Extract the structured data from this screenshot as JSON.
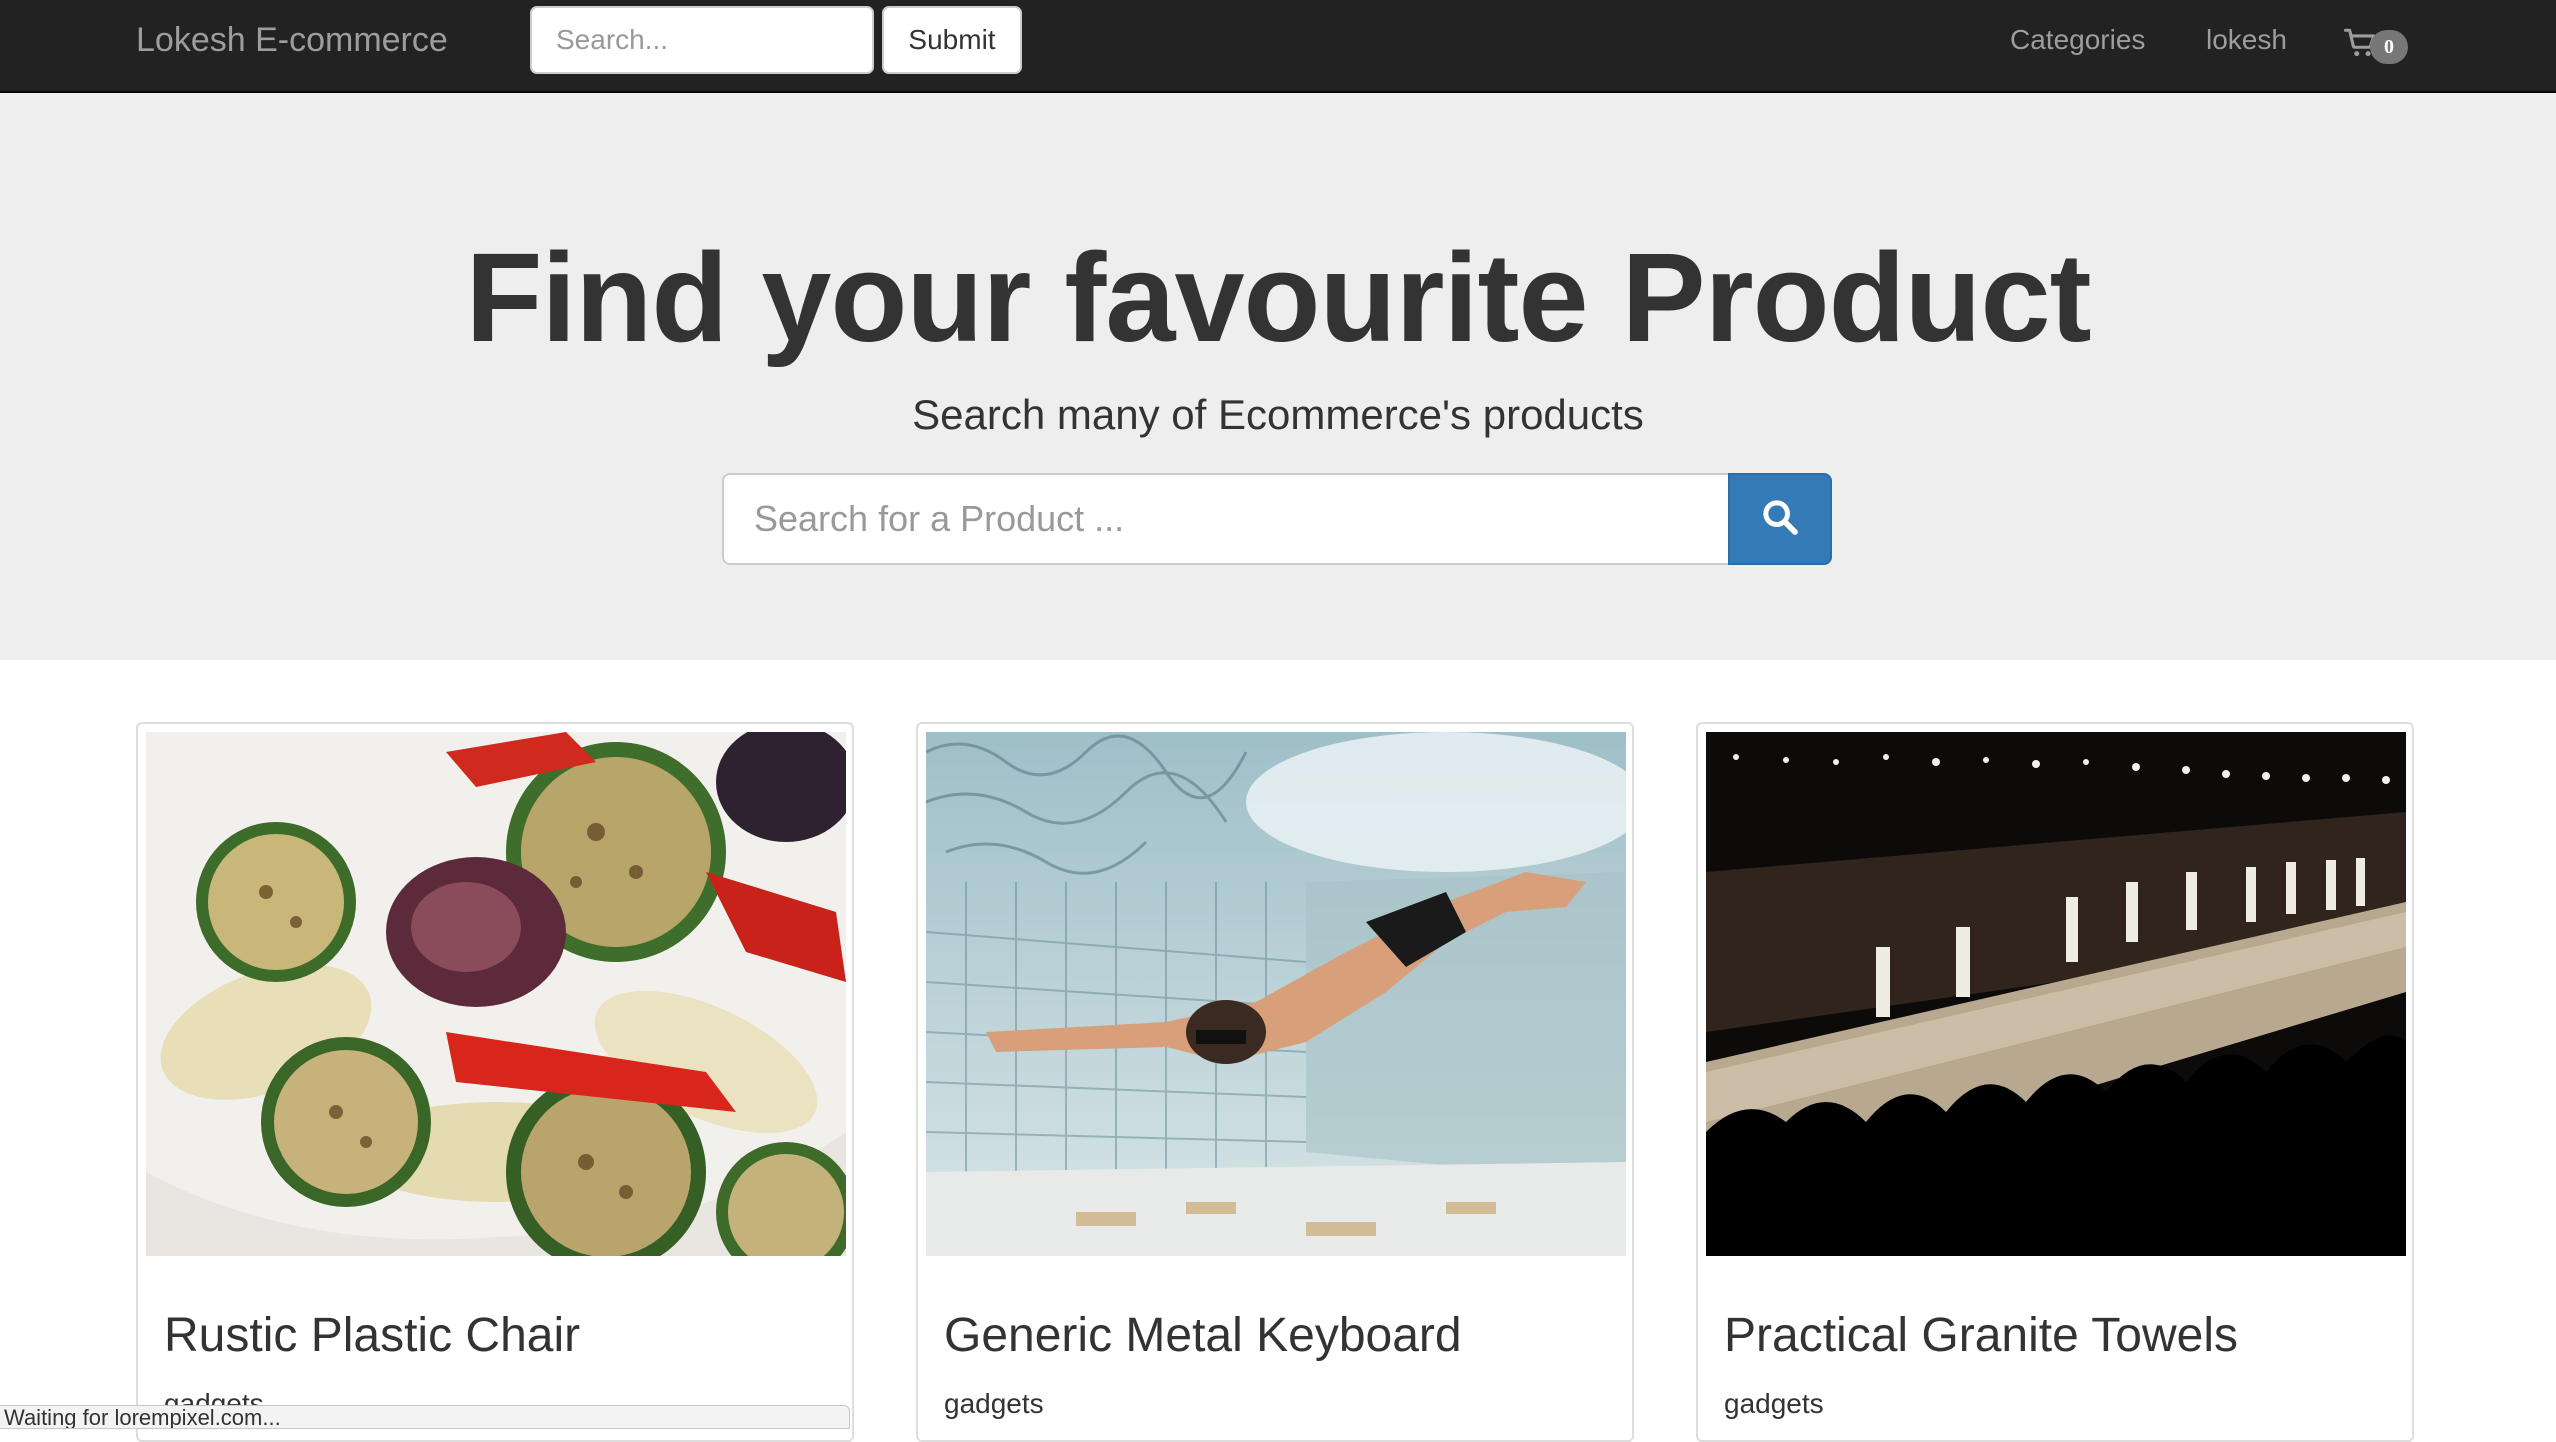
{
  "navbar": {
    "brand": "Lokesh E-commerce",
    "search_placeholder": "Search...",
    "submit_label": "Submit",
    "links": {
      "categories": "Categories",
      "user": "lokesh"
    },
    "cart": {
      "icon": "shopping-cart-icon",
      "count": "0"
    }
  },
  "hero": {
    "title": "Find your favourite Product",
    "subtitle": "Search many of Ecommerce's products",
    "search_placeholder": "Search for a Product ...",
    "search_button_icon": "search-icon",
    "accent_color": "#337ab7"
  },
  "products": [
    {
      "name": "Rustic Plastic Chair",
      "category": "gadgets",
      "image": "grilled-vegetables-photo"
    },
    {
      "name": "Generic Metal Keyboard",
      "category": "gadgets",
      "image": "underwater-swimmer-photo"
    },
    {
      "name": "Practical Granite Towels",
      "category": "gadgets",
      "image": "fashion-runway-photo"
    }
  ],
  "status_bar": {
    "text": "Waiting for lorempixel.com..."
  }
}
